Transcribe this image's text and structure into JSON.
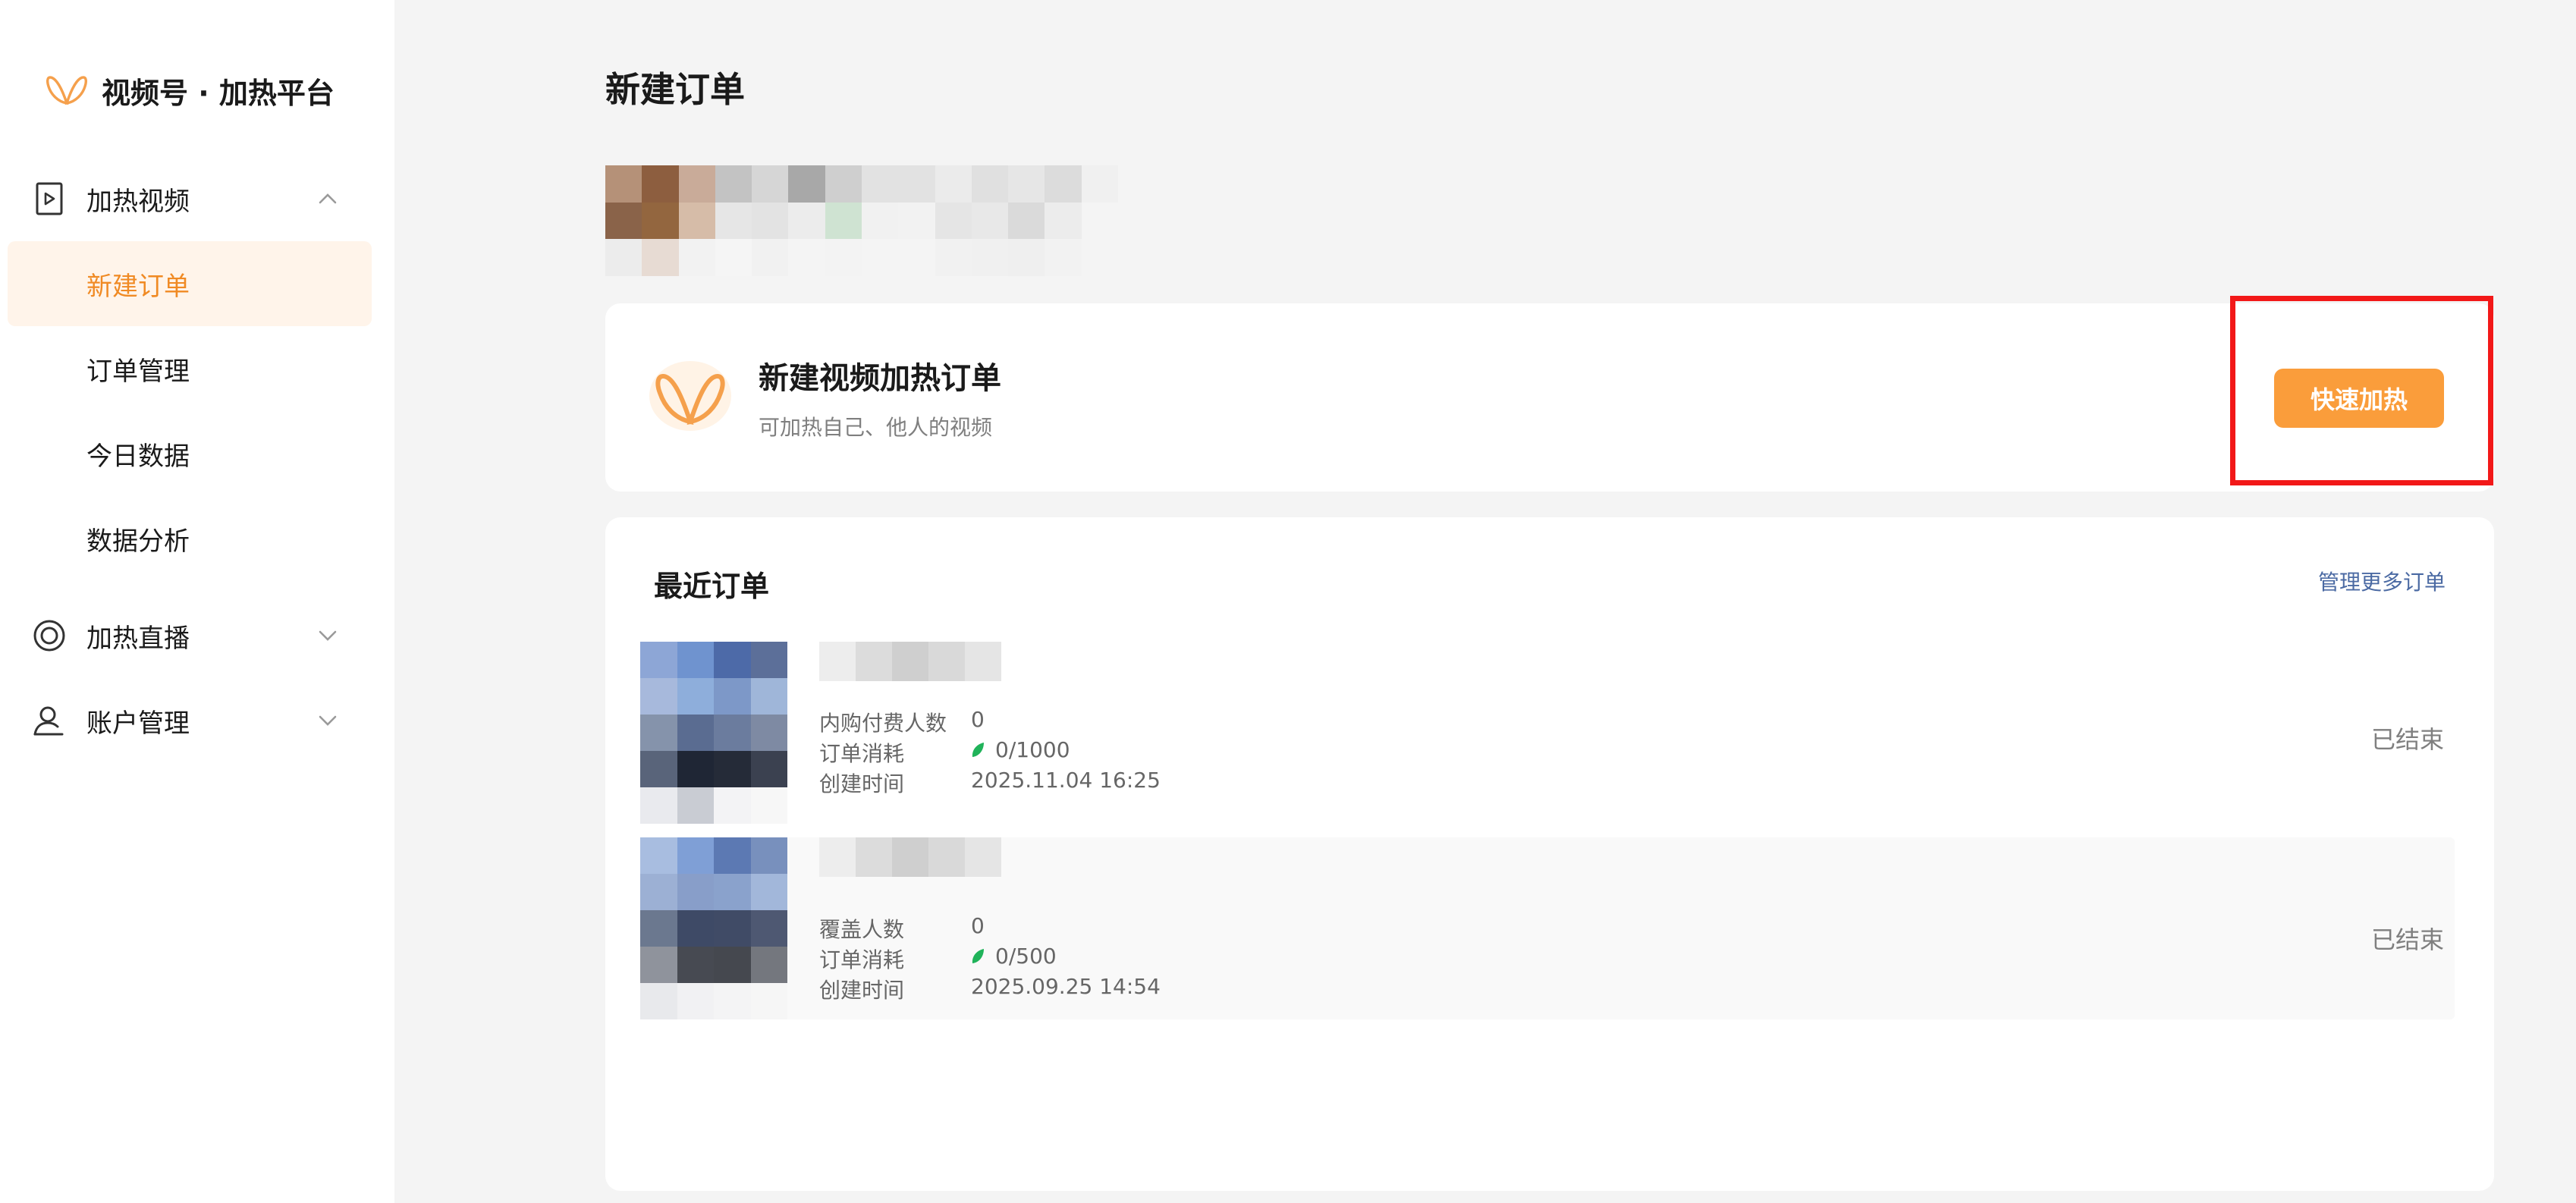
{
  "brand": {
    "name": "视频号 · 加热平台",
    "logo_icon": "butterfly-logo-icon",
    "accent": "#f5a04c"
  },
  "sidebar": {
    "groups": [
      {
        "label": "加热视频",
        "icon": "play-video-icon",
        "expanded": true
      },
      {
        "label": "加热直播",
        "icon": "live-circle-icon",
        "expanded": false
      },
      {
        "label": "账户管理",
        "icon": "user-icon",
        "expanded": false
      }
    ],
    "items": [
      {
        "label": "新建订单",
        "active": true
      },
      {
        "label": "订单管理",
        "active": false
      },
      {
        "label": "今日数据",
        "active": false
      },
      {
        "label": "数据分析",
        "active": false
      }
    ]
  },
  "main": {
    "title": "新建订单",
    "new_order": {
      "title": "新建视频加热订单",
      "subtitle": "可加热自己、他人的视频",
      "button": "快速加热",
      "button_color": "#fa9d3b",
      "highlight_color": "#f21818"
    },
    "recent": {
      "title": "最近订单",
      "more_link": "管理更多订单",
      "orders": [
        {
          "row1_label": "内购付费人数",
          "row1_value": "0",
          "row2_label": "订单消耗",
          "row2_value": "0/1000",
          "row3_label": "创建时间",
          "row3_value": "2025.11.04 16:25",
          "status": "已结束"
        },
        {
          "row1_label": "覆盖人数",
          "row1_value": "0",
          "row2_label": "订单消耗",
          "row2_value": "0/500",
          "row3_label": "创建时间",
          "row3_value": "2025.09.25 14:54",
          "status": "已结束"
        }
      ]
    }
  }
}
